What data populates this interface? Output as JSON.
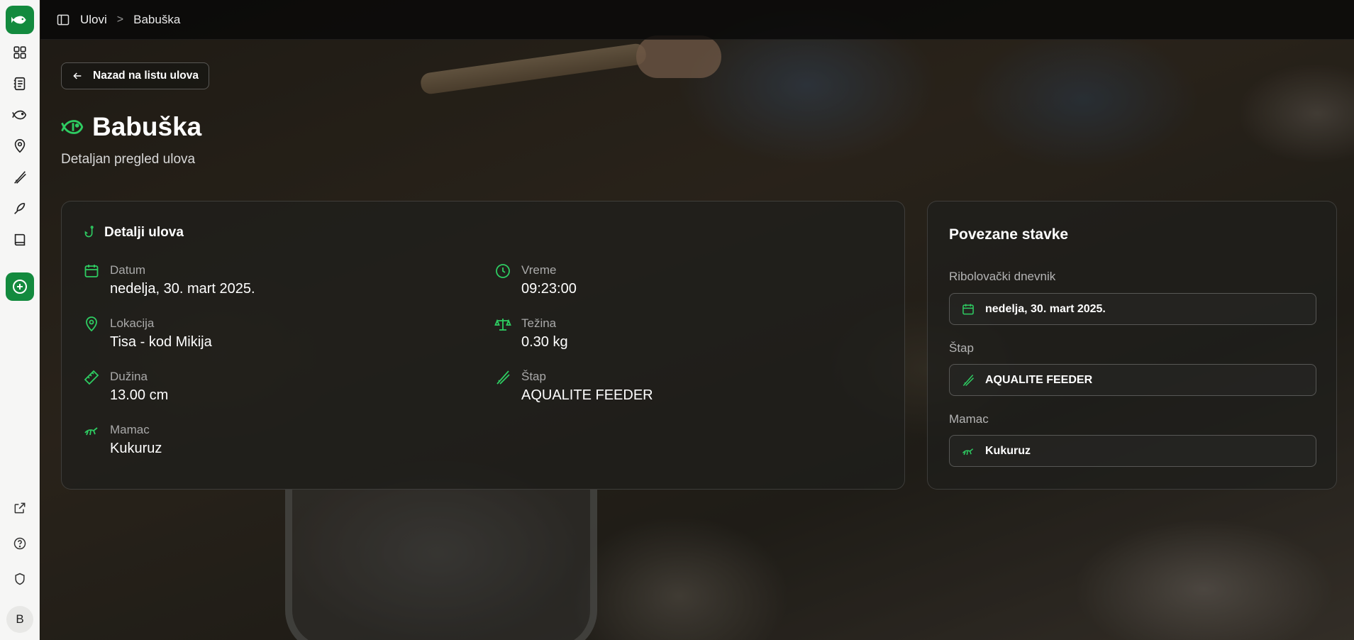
{
  "sidebar": {
    "items": [
      {
        "name": "dashboard",
        "icon": "grid-icon"
      },
      {
        "name": "journal",
        "icon": "notebook-icon"
      },
      {
        "name": "catches",
        "icon": "fish-icon"
      },
      {
        "name": "locations",
        "icon": "map-pin-icon"
      },
      {
        "name": "rods",
        "icon": "fishing-rod-icon"
      },
      {
        "name": "baits",
        "icon": "lure-icon"
      },
      {
        "name": "guide",
        "icon": "book-icon"
      }
    ],
    "bottom_items": [
      {
        "name": "external",
        "icon": "external-link-icon"
      },
      {
        "name": "help",
        "icon": "help-circle-icon"
      },
      {
        "name": "privacy",
        "icon": "shield-icon"
      }
    ],
    "avatar_initial": "B",
    "accent": "#138a3e"
  },
  "header": {
    "breadcrumb_root": "Ulovi",
    "breadcrumb_separator": ">",
    "breadcrumb_current": "Babuška"
  },
  "page": {
    "back_label": "Nazad na listu ulova",
    "title": "Babuška",
    "subtitle": "Detaljan pregled ulova"
  },
  "details": {
    "title": "Detalji ulova",
    "fields": {
      "datum": {
        "label": "Datum",
        "value": "nedelja, 30. mart 2025.",
        "icon": "calendar-icon"
      },
      "vreme": {
        "label": "Vreme",
        "value": "09:23:00",
        "icon": "clock-icon"
      },
      "lokacija": {
        "label": "Lokacija",
        "value": "Tisa - kod Mikija",
        "icon": "map-pin-icon"
      },
      "tezina": {
        "label": "Težina",
        "value": "0.30 kg",
        "icon": "scale-icon"
      },
      "duzina": {
        "label": "Dužina",
        "value": "13.00 cm",
        "icon": "ruler-icon"
      },
      "stap": {
        "label": "Štap",
        "value": "AQUALITE FEEDER",
        "icon": "fishing-rod-icon"
      },
      "mamac": {
        "label": "Mamac",
        "value": "Kukuruz",
        "icon": "bait-icon"
      }
    }
  },
  "related": {
    "title": "Povezane stavke",
    "journal_label": "Ribolovački dnevnik",
    "journal_value": "nedelja, 30. mart 2025.",
    "rod_label": "Štap",
    "rod_value": "AQUALITE FEEDER",
    "bait_label": "Mamac",
    "bait_value": "Kukuruz"
  },
  "colors": {
    "accent_green": "#2ecc62",
    "card_bg": "rgba(30,30,28,0.72)"
  }
}
